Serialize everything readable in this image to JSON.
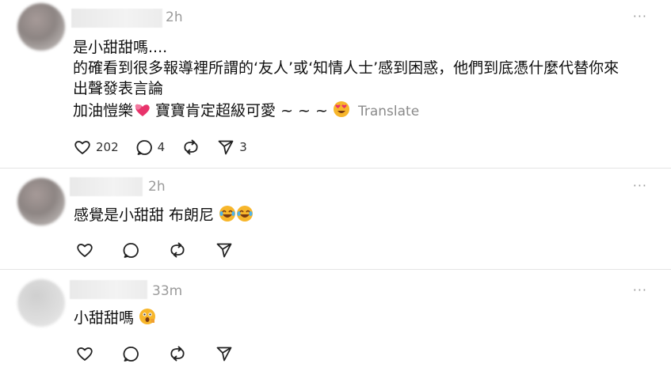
{
  "posts": [
    {
      "time": "2h",
      "lines": [
        "是小甜甜嗎....",
        "的確看到很多報導裡所謂的‘友人’或‘知情人士’感到困惑，他們到底憑什麼代替你來",
        "出聲發表言論",
        "加油愷樂"
      ],
      "line4_after_heart": " 寶寶肯定超級可愛 ~ ~ ~ ",
      "translate": "Translate",
      "counts": {
        "likes": "202",
        "comments": "4",
        "shares": "3"
      }
    },
    {
      "time": "2h",
      "text": "感覺是小甜甜 布朗尼"
    },
    {
      "time": "33m",
      "text": "小甜甜嗎"
    }
  ],
  "icons": [
    "heart-icon",
    "comment-icon",
    "repost-icon",
    "share-icon",
    "more-icon"
  ]
}
